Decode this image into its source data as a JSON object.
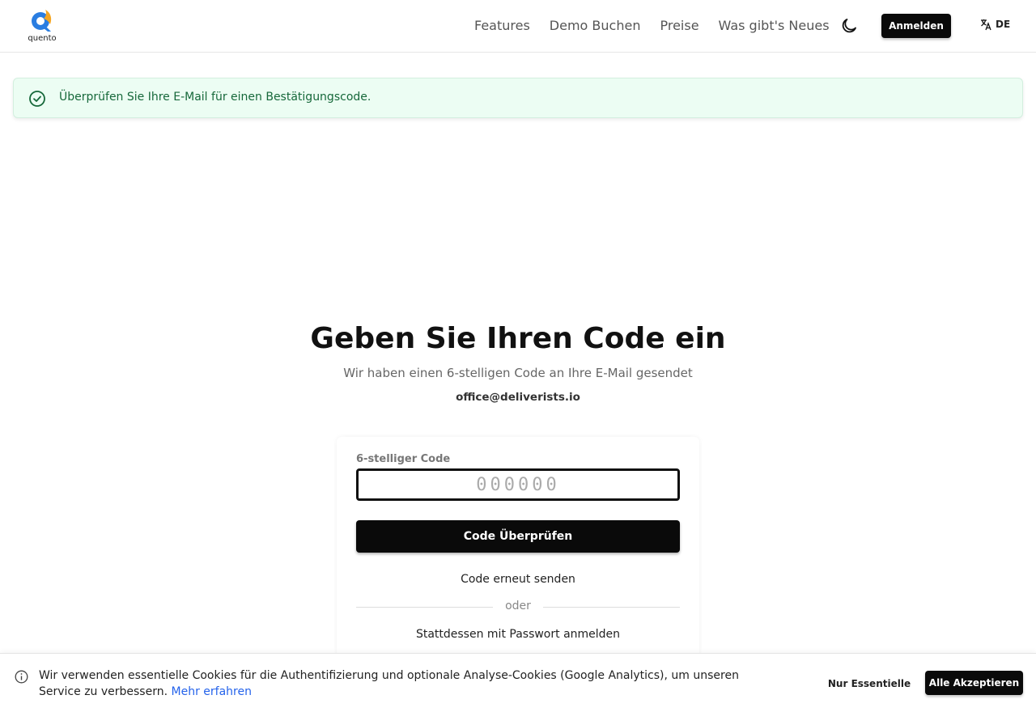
{
  "header": {
    "logo_text": "quento",
    "nav": [
      "Features",
      "Demo Buchen",
      "Preise",
      "Was gibt's Neues"
    ],
    "signin_label": "Anmelden",
    "language": "DE",
    "icons": {
      "theme": "moon-icon",
      "language": "translate-icon"
    }
  },
  "alert": {
    "message": "Überprüfen Sie Ihre E-Mail für einen Bestätigungscode.",
    "icon": "check-circle-icon",
    "color": "#16683a",
    "background": "#ecfdf3"
  },
  "main": {
    "title": "Geben Sie Ihren Code ein",
    "subtitle": "Wir haben einen 6-stelligen Code an Ihre E-Mail gesendet",
    "email": "office@deliverists.io"
  },
  "form": {
    "code_label": "6-stelliger Code",
    "code_value": "",
    "code_placeholder": "000000",
    "verify_label": "Code Überprüfen",
    "resend_label": "Code erneut senden",
    "divider_text": "oder",
    "password_link": "Stattdessen mit Passwort anmelden"
  },
  "cookie": {
    "text": "Wir verwenden essentielle Cookies für die Authentifizierung und optionale Analyse-Cookies (Google Analytics), um unseren Service zu verbessern.",
    "link_text": "Mehr erfahren",
    "essential_label": "Nur Essentielle",
    "accept_label": "Alle Akzeptieren",
    "icon": "info-icon"
  },
  "colors": {
    "primary": "#0a0a0a",
    "link": "#2563eb",
    "logo_blue": "#2a7de1",
    "logo_orange": "#f5a623"
  }
}
